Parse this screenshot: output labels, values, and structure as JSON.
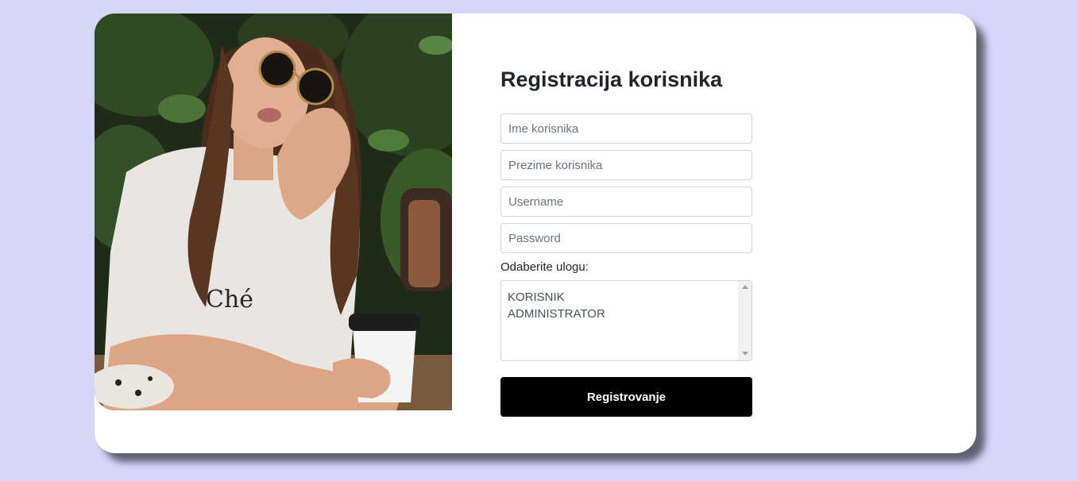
{
  "form": {
    "title": "Registracija korisnika",
    "first_name_placeholder": "Ime korisnika",
    "last_name_placeholder": "Prezime korisnika",
    "username_placeholder": "Username",
    "password_placeholder": "Password",
    "role_label": "Odaberite ulogu:",
    "role_options": [
      "KORISNIK",
      "ADMINISTRATOR"
    ],
    "submit_label": "Registrovanje"
  },
  "photo": {
    "shirt_print": "Ché"
  },
  "colors": {
    "page_background": "#d6d6fb",
    "card_background": "#ffffff",
    "button_background": "#000000",
    "button_text": "#ffffff"
  }
}
